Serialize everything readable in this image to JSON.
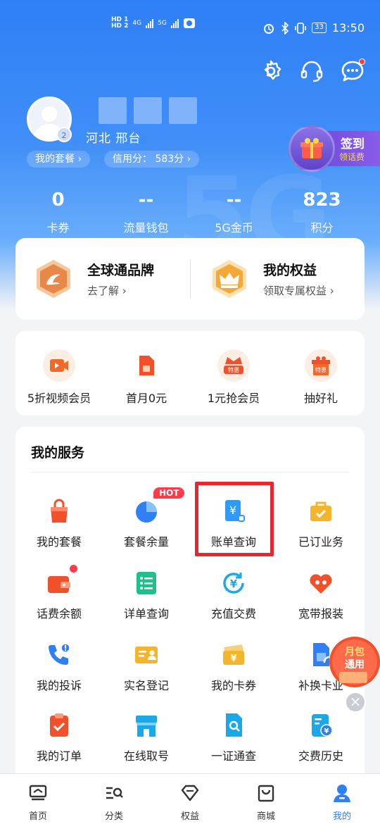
{
  "status_bar": {
    "hd1": "HD 1",
    "hd2": "HD 2",
    "net1": "4G",
    "net2": "5G",
    "battery": "33",
    "time": "13:50"
  },
  "user": {
    "location": "河北  邢台",
    "avatar_badge": "2",
    "package_label": "我的套餐 ›",
    "credit_label": "信用分： 583分 ›"
  },
  "checkin": {
    "title": "签到",
    "subtitle": "领话费"
  },
  "stats": [
    {
      "value": "0",
      "label": "卡券"
    },
    {
      "value": "--",
      "label": "流量钱包"
    },
    {
      "value": "--",
      "label": "5G金币"
    },
    {
      "value": "823",
      "label": "积分"
    }
  ],
  "brand": {
    "left": {
      "title": "全球通品牌",
      "subtitle": "去了解 ›"
    },
    "right": {
      "title": "我的权益",
      "subtitle": "领取专属权益 ›"
    }
  },
  "promos": [
    {
      "label": "5折视频会员"
    },
    {
      "label": "首月0元"
    },
    {
      "label": "1元抢会员",
      "badge": "特惠"
    },
    {
      "label": "抽好礼",
      "badge": "特惠"
    }
  ],
  "services": {
    "title": "我的服务",
    "hot": "HOT",
    "items": [
      {
        "label": "我的套餐"
      },
      {
        "label": "套餐余量"
      },
      {
        "label": "账单查询"
      },
      {
        "label": "已订业务"
      },
      {
        "label": "话费余额"
      },
      {
        "label": "详单查询"
      },
      {
        "label": "充值交费"
      },
      {
        "label": "宽带报装"
      },
      {
        "label": "我的投诉"
      },
      {
        "label": "实名登记"
      },
      {
        "label": "我的卡券"
      },
      {
        "label": "补换卡业"
      },
      {
        "label": "我的订单"
      },
      {
        "label": "在线取号"
      },
      {
        "label": "一证通查"
      },
      {
        "label": "交费历史"
      }
    ]
  },
  "float_promo": {
    "line1": "月包",
    "line2": "通用"
  },
  "tabs": [
    {
      "label": "首页"
    },
    {
      "label": "分类"
    },
    {
      "label": "权益"
    },
    {
      "label": "商城"
    },
    {
      "label": "我的"
    }
  ],
  "colors": {
    "brand_blue": "#2f7ff6",
    "accent_red": "#e8262e",
    "orange": "#f0682a"
  }
}
